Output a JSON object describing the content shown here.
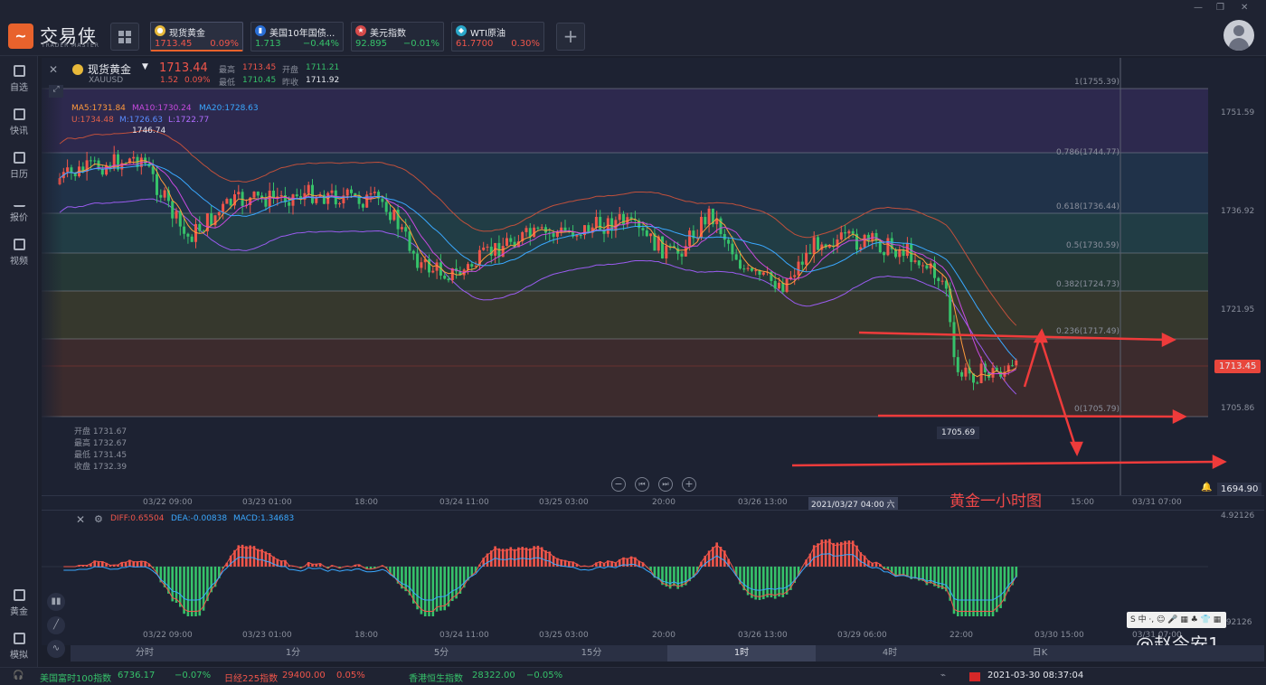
{
  "app": {
    "logo_mark": "~",
    "name": "交易侠",
    "subtitle": "TRADER MASTER"
  },
  "tickers": [
    {
      "name": "现货黄金",
      "price": "1713.45",
      "change": "0.09%",
      "icon": "gold-coin-icon",
      "color": "#e8b93a",
      "dir": "up"
    },
    {
      "name": "美国10年国债...",
      "price": "1.713",
      "change": "−0.44%",
      "icon": "bar-chart-icon",
      "color": "#2a6fd6",
      "dir": "down"
    },
    {
      "name": "美元指数",
      "price": "92.895",
      "change": "−0.01%",
      "icon": "us-flag-icon",
      "color": "#d64a4a",
      "dir": "down"
    },
    {
      "name": "WTI原油",
      "price": "61.7700",
      "change": "0.30%",
      "icon": "oil-drop-icon",
      "color": "#2aa7c9",
      "dir": "up"
    }
  ],
  "sidebar": {
    "items": [
      {
        "label": "自选",
        "icon": "bookmark-icon"
      },
      {
        "label": "快讯",
        "icon": "news-icon"
      },
      {
        "label": "日历",
        "icon": "calendar-icon"
      },
      {
        "label": "报价",
        "icon": "quote-icon"
      },
      {
        "label": "视频",
        "icon": "video-icon"
      }
    ],
    "bottom_items": [
      {
        "label": "黄金",
        "icon": "gold-icon"
      },
      {
        "label": "模拟",
        "icon": "simulate-icon"
      }
    ]
  },
  "symbol": {
    "name": "现货黄金",
    "code": "XAUUSD",
    "price": "1713.44",
    "change": "1.52",
    "change_pct": "0.09%",
    "high_label": "最高",
    "high": "1713.45",
    "open_label": "开盘",
    "open": "1711.21",
    "low_label": "最低",
    "low": "1710.45",
    "prev_label": "昨收",
    "prev": "1711.92"
  },
  "indicators": {
    "ma5": "MA5:1731.84",
    "ma10": "MA10:1730.24",
    "ma20": "MA20:1728.63",
    "boll_u": "U:1734.48",
    "boll_m": "M:1726.63",
    "boll_l": "L:1722.77",
    "hi_marker": "1746.74",
    "lo_marker": "1705.69"
  },
  "fib_levels": [
    {
      "label": "1(1755.39)"
    },
    {
      "label": "0.786(1744.77)"
    },
    {
      "label": "0.618(1736.44)"
    },
    {
      "label": "0.5(1730.59)"
    },
    {
      "label": "0.382(1724.73)"
    },
    {
      "label": "0.236(1717.49)"
    },
    {
      "label": "0(1705.79)"
    }
  ],
  "price_axis": [
    "1751.59",
    "1736.92",
    "1721.95",
    "1705.86"
  ],
  "current_price_tag": "1713.45",
  "alert_price": "1694.90",
  "ohlc_box": [
    "开盘 1731.67",
    "最高 1732.67",
    "最低 1731.45",
    "收盘 1732.39"
  ],
  "time_axis": [
    "03/22 09:00",
    "03/23 01:00",
    "18:00",
    "03/24 11:00",
    "03/25 03:00",
    "20:00",
    "03/26 13:00",
    "15:00",
    "03/31 07:00"
  ],
  "crosshair_time": "2021/03/27 04:00 六",
  "annotation": "黄金一小时图",
  "macd": {
    "diff": "DIFF:0.65504",
    "dea": "DEA:-0.00838",
    "macd": "MACD:1.34683",
    "axis_top": "4.92126",
    "axis_bottom": "-4.92126",
    "time_axis": [
      "03/22 09:00",
      "03/23 01:00",
      "18:00",
      "03/24 11:00",
      "03/25 03:00",
      "20:00",
      "03/26 13:00",
      "03/29 06:00",
      "22:00",
      "03/30 15:00",
      "03/31 07:00"
    ]
  },
  "periods": [
    "分时",
    "1分",
    "5分",
    "15分",
    "1时",
    "4时",
    "日K"
  ],
  "active_period": "1时",
  "watermark": "@赵今安1",
  "status": {
    "items": [
      {
        "name": "美国富时100指数",
        "value": "6736.17",
        "change": "−0.07%"
      },
      {
        "name": "日经225指数",
        "value": "29400.00",
        "change": "0.05%"
      },
      {
        "name": "香港恒生指数",
        "value": "28322.00",
        "change": "−0.05%"
      }
    ],
    "datetime": "2021-03-30 08:37:04"
  },
  "colors": {
    "up": "#f0554a",
    "down": "#36c26a",
    "accent": "#e8622c"
  }
}
